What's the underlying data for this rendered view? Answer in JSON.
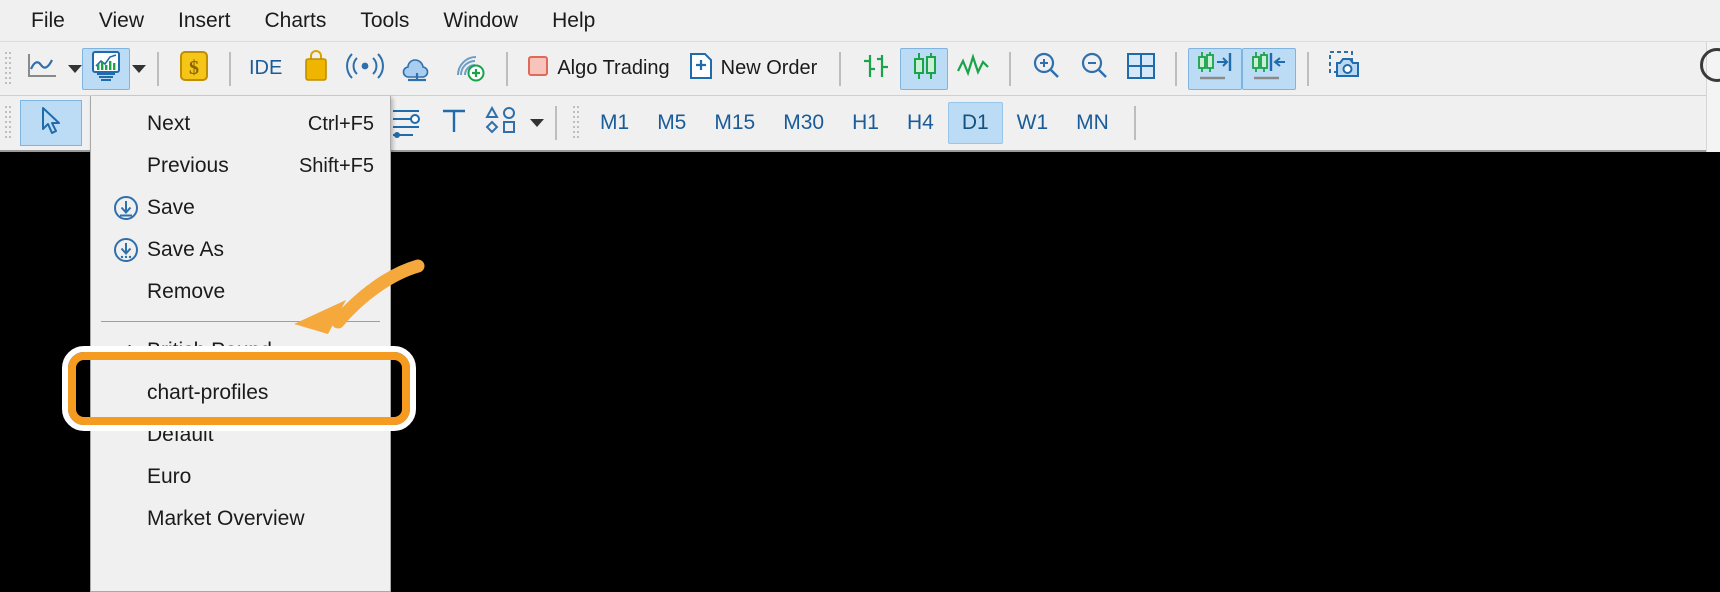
{
  "menubar": {
    "items": [
      {
        "label": "File"
      },
      {
        "label": "View"
      },
      {
        "label": "Insert"
      },
      {
        "label": "Charts"
      },
      {
        "label": "Tools"
      },
      {
        "label": "Window"
      },
      {
        "label": "Help"
      }
    ]
  },
  "toolbar_main": {
    "line_chart_button": {
      "icon": "line-chart-icon",
      "label": ""
    },
    "line_chart_caret": {
      "icon": "chevron-down-icon"
    },
    "profiles_button": {
      "icon": "chart-profiles-icon",
      "label": "",
      "active": true
    },
    "profiles_caret": {
      "icon": "chevron-down-icon"
    },
    "market_watch_button": {
      "icon": "dollar-gold-icon"
    },
    "ide_button": {
      "label": "IDE"
    },
    "market_button": {
      "icon": "shopping-bag-icon"
    },
    "signals_button": {
      "icon": "broadcast-icon"
    },
    "vps_button": {
      "icon": "cloud-icon"
    },
    "copy_signal_button": {
      "icon": "signal-add-icon"
    },
    "algo_trading": {
      "icon": "stop-square-icon",
      "label": "Algo Trading"
    },
    "new_order": {
      "icon": "new-document-plus-icon",
      "label": "New Order"
    },
    "bar_chart_button": {
      "icon": "bar-chart-icon"
    },
    "candlestick_button": {
      "icon": "candlestick-icon",
      "active": true
    },
    "line_graph_button": {
      "icon": "zigzag-line-icon"
    },
    "zoom_in_button": {
      "icon": "zoom-in-icon"
    },
    "zoom_out_button": {
      "icon": "zoom-out-icon"
    },
    "grid_button": {
      "icon": "grid-icon"
    },
    "auto_scroll_button": {
      "icon": "chart-shift-right-icon",
      "active": true
    },
    "chart_shift_button": {
      "icon": "chart-shift-left-icon",
      "active": true
    },
    "screenshot_button": {
      "icon": "camera-snapshot-icon"
    }
  },
  "toolbar_objects": {
    "cursor_button": {
      "icon": "arrow-cursor-icon",
      "active": true
    },
    "crosshair_button": {
      "icon": "crosshair-icon"
    },
    "trendline_button": {
      "icon": "trendline-icon"
    },
    "channel_button": {
      "icon": "channels-icon"
    },
    "levels_button": {
      "icon": "fibonacci-levels-icon"
    },
    "text_button": {
      "icon": "text-tool-icon"
    },
    "shapes_button": {
      "icon": "shapes-icon"
    },
    "shapes_caret": {
      "icon": "chevron-down-icon"
    },
    "timeframes": [
      {
        "label": "M1",
        "active": false
      },
      {
        "label": "M5",
        "active": false
      },
      {
        "label": "M15",
        "active": false
      },
      {
        "label": "M30",
        "active": false
      },
      {
        "label": "H1",
        "active": false
      },
      {
        "label": "H4",
        "active": false
      },
      {
        "label": "D1",
        "active": true
      },
      {
        "label": "W1",
        "active": false
      },
      {
        "label": "MN",
        "active": false
      }
    ]
  },
  "dropdown": {
    "items": [
      {
        "label": "Next",
        "accel": "Ctrl+F5",
        "icon": "",
        "checked": false,
        "submenu": false
      },
      {
        "label": "Previous",
        "accel": "Shift+F5",
        "icon": "",
        "checked": false,
        "submenu": false
      },
      {
        "label": "Save",
        "accel": "",
        "icon": "save-down-circle-icon",
        "checked": false,
        "submenu": false
      },
      {
        "label": "Save As",
        "accel": "",
        "icon": "save-as-down-circle-icon",
        "checked": false,
        "submenu": false
      },
      {
        "label": "Remove",
        "accel": "",
        "icon": "",
        "checked": false,
        "submenu": true
      }
    ],
    "profiles": [
      {
        "label": "British Pound",
        "checked": true
      },
      {
        "label": "chart-profiles",
        "checked": false
      },
      {
        "label": "Default",
        "checked": false
      },
      {
        "label": "Euro",
        "checked": false
      },
      {
        "label": "Market Overview",
        "checked": false
      }
    ],
    "check_glyph": "✓"
  },
  "annotation": {
    "target_label": "chart-profiles",
    "highlight_color": "#f59b20",
    "outline_color": "#ffffff",
    "arrow_color": "#f5a93c"
  },
  "colors": {
    "toolbar_bg": "#f0f0f0",
    "chart_bg": "#000000",
    "active_button": "#bcdcf5",
    "accent_blue": "#1a5c99",
    "green_candle": "#16a34a",
    "gold": "#e8b20a",
    "red_square": "#e8776a",
    "annotation_orange": "#f59b20"
  }
}
